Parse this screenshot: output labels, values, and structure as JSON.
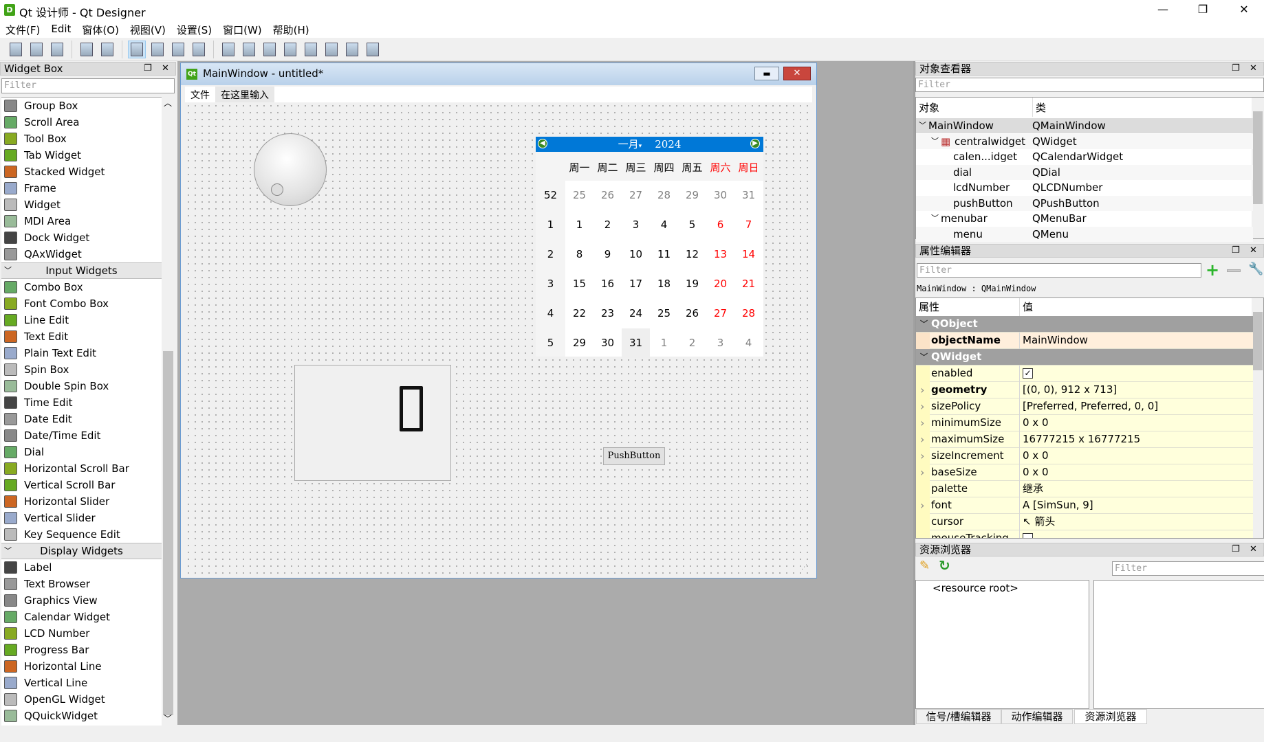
{
  "app": {
    "title": "Qt 设计师 - Qt Designer",
    "icon_letter": "D",
    "minimize": "—",
    "restore": "❐",
    "close": "✕"
  },
  "menu": [
    "文件(F)",
    "Edit",
    "窗体(O)",
    "视图(V)",
    "设置(S)",
    "窗口(W)",
    "帮助(H)"
  ],
  "toolbar": {
    "groups": [
      [
        "new-file",
        "open-file",
        "save-file"
      ],
      [
        "send-to-back",
        "bring-to-front"
      ],
      [
        "edit-widgets",
        "edit-signals-slots",
        "edit-buddies",
        "edit-tab-order"
      ],
      [
        "layout-horizontal",
        "layout-vertical",
        "layout-horizontal-splitter",
        "layout-vertical-splitter",
        "layout-grid",
        "layout-form",
        "break-layout",
        "adjust-size"
      ]
    ],
    "active": "edit-widgets"
  },
  "widget_box": {
    "title": "Widget Box",
    "filter_placeholder": "Filter",
    "rows": [
      {
        "label": "Group Box",
        "icon": "group-box"
      },
      {
        "label": "Scroll Area",
        "icon": "scroll-area"
      },
      {
        "label": "Tool Box",
        "icon": "tool-box"
      },
      {
        "label": "Tab Widget",
        "icon": "tab-widget"
      },
      {
        "label": "Stacked Widget",
        "icon": "stacked-widget"
      },
      {
        "label": "Frame",
        "icon": "frame"
      },
      {
        "label": "Widget",
        "icon": "widget"
      },
      {
        "label": "MDI Area",
        "icon": "mdi-area"
      },
      {
        "label": "Dock Widget",
        "icon": "dock-widget"
      },
      {
        "label": "QAxWidget",
        "icon": "qaxwidget"
      },
      {
        "header": "Input Widgets"
      },
      {
        "label": "Combo Box",
        "icon": "combo-box"
      },
      {
        "label": "Font Combo Box",
        "icon": "font-combo-box"
      },
      {
        "label": "Line Edit",
        "icon": "line-edit"
      },
      {
        "label": "Text Edit",
        "icon": "text-edit"
      },
      {
        "label": "Plain Text Edit",
        "icon": "plain-text-edit"
      },
      {
        "label": "Spin Box",
        "icon": "spin-box"
      },
      {
        "label": "Double Spin Box",
        "icon": "double-spin-box"
      },
      {
        "label": "Time Edit",
        "icon": "time-edit"
      },
      {
        "label": "Date Edit",
        "icon": "date-edit"
      },
      {
        "label": "Date/Time Edit",
        "icon": "datetime-edit"
      },
      {
        "label": "Dial",
        "icon": "dial"
      },
      {
        "label": "Horizontal Scroll Bar",
        "icon": "horizontal-scroll-bar"
      },
      {
        "label": "Vertical Scroll Bar",
        "icon": "vertical-scroll-bar"
      },
      {
        "label": "Horizontal Slider",
        "icon": "horizontal-slider"
      },
      {
        "label": "Vertical Slider",
        "icon": "vertical-slider"
      },
      {
        "label": "Key Sequence Edit",
        "icon": "key-sequence-edit"
      },
      {
        "header": "Display Widgets"
      },
      {
        "label": "Label",
        "icon": "label"
      },
      {
        "label": "Text Browser",
        "icon": "text-browser"
      },
      {
        "label": "Graphics View",
        "icon": "graphics-view"
      },
      {
        "label": "Calendar Widget",
        "icon": "calendar-widget"
      },
      {
        "label": "LCD Number",
        "icon": "lcd-number"
      },
      {
        "label": "Progress Bar",
        "icon": "progress-bar"
      },
      {
        "label": "Horizontal Line",
        "icon": "horizontal-line"
      },
      {
        "label": "Vertical Line",
        "icon": "vertical-line"
      },
      {
        "label": "OpenGL Widget",
        "icon": "opengl-widget"
      },
      {
        "label": "QQuickWidget",
        "icon": "qquickwidget"
      }
    ]
  },
  "form": {
    "title": "MainWindow - untitled*",
    "menu": [
      "文件",
      "在这里输入"
    ],
    "pushbutton": "PushButton",
    "lcd_value": "0",
    "calendar": {
      "month": "一月",
      "year": "2024",
      "weekdays": [
        "周一",
        "周二",
        "周三",
        "周四",
        "周五",
        "周六",
        "周日"
      ],
      "weeks": [
        {
          "week": "52",
          "days": [
            "25",
            "26",
            "27",
            "28",
            "29",
            "30",
            "31"
          ],
          "muted": [
            0,
            1,
            2,
            3,
            4,
            5,
            6
          ]
        },
        {
          "week": "1",
          "days": [
            "1",
            "2",
            "3",
            "4",
            "5",
            "6",
            "7"
          ],
          "muted": []
        },
        {
          "week": "2",
          "days": [
            "8",
            "9",
            "10",
            "11",
            "12",
            "13",
            "14"
          ],
          "muted": []
        },
        {
          "week": "3",
          "days": [
            "15",
            "16",
            "17",
            "18",
            "19",
            "20",
            "21"
          ],
          "muted": []
        },
        {
          "week": "4",
          "days": [
            "22",
            "23",
            "24",
            "25",
            "26",
            "27",
            "28"
          ],
          "muted": []
        },
        {
          "week": "5",
          "days": [
            "29",
            "30",
            "31",
            "1",
            "2",
            "3",
            "4"
          ],
          "muted": [
            3,
            4,
            5,
            6
          ]
        }
      ],
      "selected": "31",
      "weekend_color": "#ff0000",
      "header_color": "#0078d7"
    }
  },
  "object_inspector": {
    "title": "对象查看器",
    "filter_placeholder": "Filter",
    "col_object": "对象",
    "col_class": "类",
    "rows": [
      {
        "name": "MainWindow",
        "class": "QMainWindow",
        "depth": 0,
        "expanded": true
      },
      {
        "name": "centralwidget",
        "class": "QWidget",
        "depth": 1,
        "expanded": true
      },
      {
        "name": "calen...idget",
        "class": "QCalendarWidget",
        "depth": 2
      },
      {
        "name": "dial",
        "class": "QDial",
        "depth": 2
      },
      {
        "name": "lcdNumber",
        "class": "QLCDNumber",
        "depth": 2
      },
      {
        "name": "pushButton",
        "class": "QPushButton",
        "depth": 2
      },
      {
        "name": "menubar",
        "class": "QMenuBar",
        "depth": 1,
        "expanded": true
      },
      {
        "name": "menu",
        "class": "QMenu",
        "depth": 2
      }
    ]
  },
  "property_editor": {
    "title": "属性编辑器",
    "filter_placeholder": "Filter",
    "context": "MainWindow : QMainWindow",
    "col_property": "属性",
    "col_value": "值",
    "rows": [
      {
        "group": "QObject"
      },
      {
        "name": "objectName",
        "value": "MainWindow",
        "bold": true,
        "tint": "orange"
      },
      {
        "group": "QWidget"
      },
      {
        "name": "enabled",
        "checkbox": true,
        "checked": true
      },
      {
        "name": "geometry",
        "value": "[(0, 0), 912 x 713]",
        "bold": true,
        "expandable": true
      },
      {
        "name": "sizePolicy",
        "value": "[Preferred, Preferred, 0, 0]",
        "expandable": true
      },
      {
        "name": "minimumSize",
        "value": "0 x 0",
        "expandable": true
      },
      {
        "name": "maximumSize",
        "value": "16777215 x 16777215",
        "expandable": true
      },
      {
        "name": "sizeIncrement",
        "value": "0 x 0",
        "expandable": true
      },
      {
        "name": "baseSize",
        "value": "0 x 0",
        "expandable": true
      },
      {
        "name": "palette",
        "value": "继承"
      },
      {
        "name": "font",
        "value": "A  [SimSun, 9]",
        "expandable": true
      },
      {
        "name": "cursor",
        "value": "↖  箭头"
      },
      {
        "name": "mouseTracking",
        "checkbox": true,
        "checked": false
      }
    ]
  },
  "resource_browser": {
    "title": "资源浏览器",
    "filter_placeholder": "Filter",
    "root": "<resource root>"
  },
  "bottom_tabs": [
    "信号/槽编辑器",
    "动作编辑器",
    "资源浏览器"
  ],
  "active_bottom_tab": 2
}
